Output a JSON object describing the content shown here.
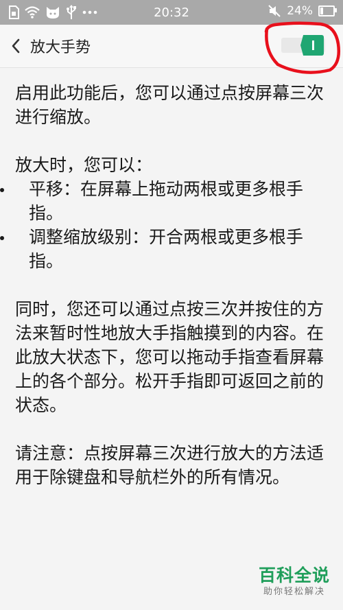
{
  "status_bar": {
    "time": "20:32",
    "battery_percent_text": "24%",
    "battery_level": 0.24,
    "left_icons": [
      "sim-card-icon",
      "wifi-icon",
      "cat-icon",
      "usb-icon",
      "more-dots-icon"
    ],
    "right_icons": [
      "mute-icon",
      "battery-icon"
    ]
  },
  "header": {
    "back_icon": "chevron-left-icon",
    "title": "放大手势",
    "toggle": {
      "state": "on",
      "color": "#1fa672"
    }
  },
  "content": {
    "intro": "启用此功能后，您可以通过点按屏幕三次进行缩放。",
    "zoom_title": "放大时，您可以：",
    "bullets": [
      "平移：在屏幕上拖动两根或更多根手指。",
      "调整缩放级别：开合两根或更多根手指。"
    ],
    "hold_paragraph": "同时，您还可以通过点按三次并按住的方法来暂时性地放大手指触摸到的内容。在此放大状态下，您可以拖动手指查看屏幕上的各个部分。松开手指即可返回之前的状态。",
    "note": "请注意：点按屏幕三次进行放大的方法适用于除键盘和导航栏外的所有情况。"
  },
  "watermark": {
    "main": "百科全说",
    "sub": "助你轻松解决"
  },
  "colors": {
    "status_bar_bg": "#a9a9a9",
    "accent_green": "#1fa672",
    "annotation_red": "#e8101c"
  }
}
